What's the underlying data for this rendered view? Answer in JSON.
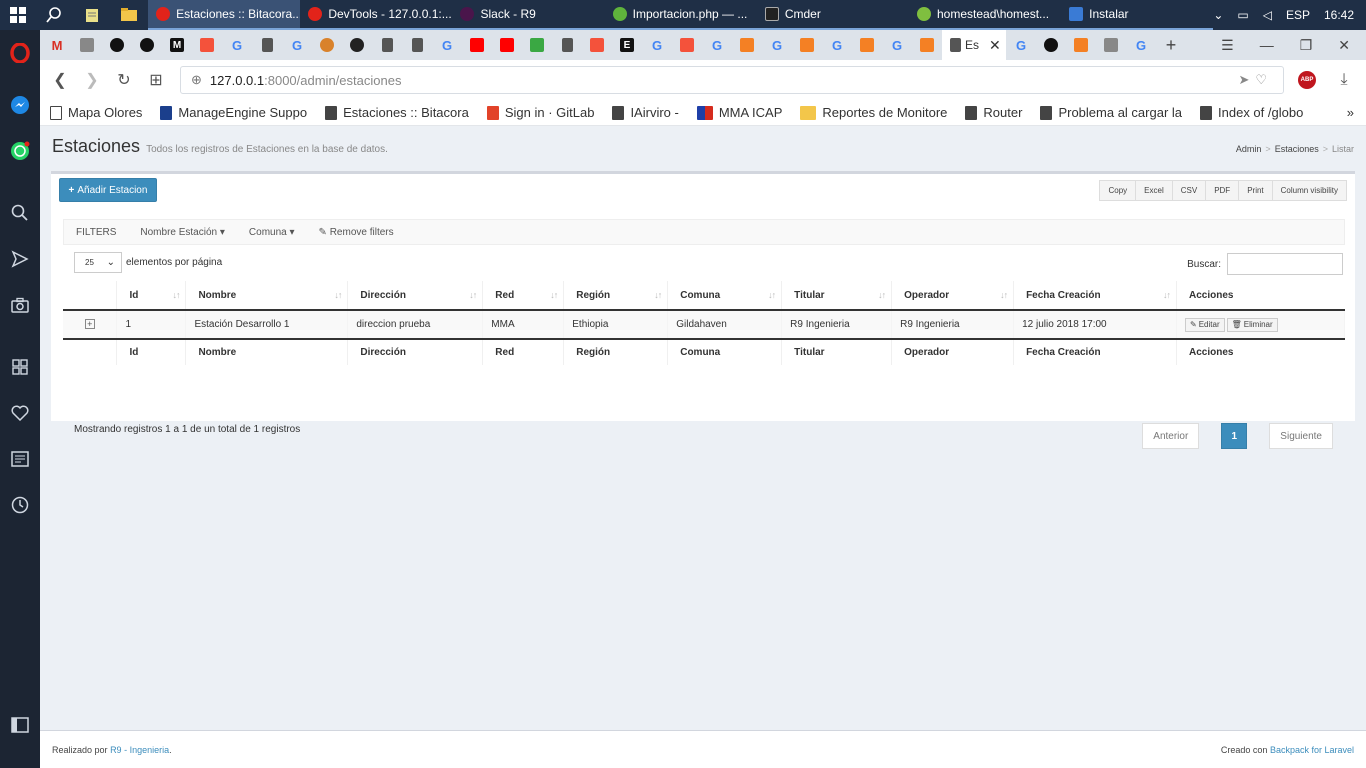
{
  "taskbar": {
    "tasks": [
      {
        "label": "Estaciones :: Bitacora...",
        "color": "#e2231a",
        "active": true
      },
      {
        "label": "DevTools - 127.0.0.1:...",
        "color": "#e2231a"
      },
      {
        "label": "Slack - R9",
        "color": "#4a154b"
      },
      {
        "label": "Importacion.php — ...",
        "color": "#5fb33c"
      },
      {
        "label": "Cmder",
        "color": "#222222"
      },
      {
        "label": "homestead\\homest...",
        "color": "#7fbf3f"
      },
      {
        "label": "Instalar",
        "color": "#3a7bd5"
      }
    ],
    "language": "ESP",
    "time": "16:42"
  },
  "browser_tab": {
    "label": "Es"
  },
  "address": {
    "host": "127.0.0.1",
    "path": ":8000/admin/estaciones"
  },
  "bookmarks": [
    "Mapa Olores",
    "ManageEngine Suppo",
    "Estaciones :: Bitacora",
    "Sign in · GitLab",
    "IAirviro -",
    "MMA ICAP",
    "Reportes de Monitore",
    "Router",
    "Problema al cargar la",
    "Index of /globo"
  ],
  "header": {
    "title": "Estaciones",
    "subtitle": "Todos los registros de Estaciones en la base de datos.",
    "breadcrumb": [
      "Admin",
      "Estaciones",
      "Listar"
    ]
  },
  "toolbar": {
    "add_label": "Añadir Estacion",
    "export_buttons": [
      "Copy",
      "Excel",
      "CSV",
      "PDF",
      "Print",
      "Column visibility"
    ]
  },
  "filters": {
    "label": "FILTERS",
    "items": [
      "Nombre Estación",
      "Comuna"
    ],
    "remove": "Remove filters"
  },
  "length": {
    "value": "25",
    "label": "elementos por página"
  },
  "search": {
    "label": "Buscar:"
  },
  "table": {
    "columns": [
      "Id",
      "Nombre",
      "Dirección",
      "Red",
      "Región",
      "Comuna",
      "Titular",
      "Operador",
      "Fecha Creación",
      "Acciones"
    ],
    "rows": [
      {
        "id": "1",
        "nombre": "Estación Desarrollo 1",
        "direccion": "direccion prueba",
        "red": "MMA",
        "region": "Ethiopia",
        "comuna": "Gildahaven",
        "titular": "R9 Ingenieria",
        "operador": "R9 Ingenieria",
        "fecha": "12 julio 2018 17:00"
      }
    ],
    "row_actions": [
      "Editar",
      "Eliminar"
    ]
  },
  "info": "Mostrando registros 1 a 1 de un total de 1 registros",
  "pagination": {
    "prev": "Anterior",
    "current": "1",
    "next": "Siguiente"
  },
  "footer": {
    "left_prefix": "Realizado por",
    "left_link": "R9 - Ingenieria",
    "left_suffix": ".",
    "right_prefix": "Creado con",
    "right_link": "Backpack for Laravel"
  },
  "colors": {
    "primary": "#3c8dbc",
    "taskbar": "#1f2f46",
    "sidebar": "#1c2533"
  }
}
